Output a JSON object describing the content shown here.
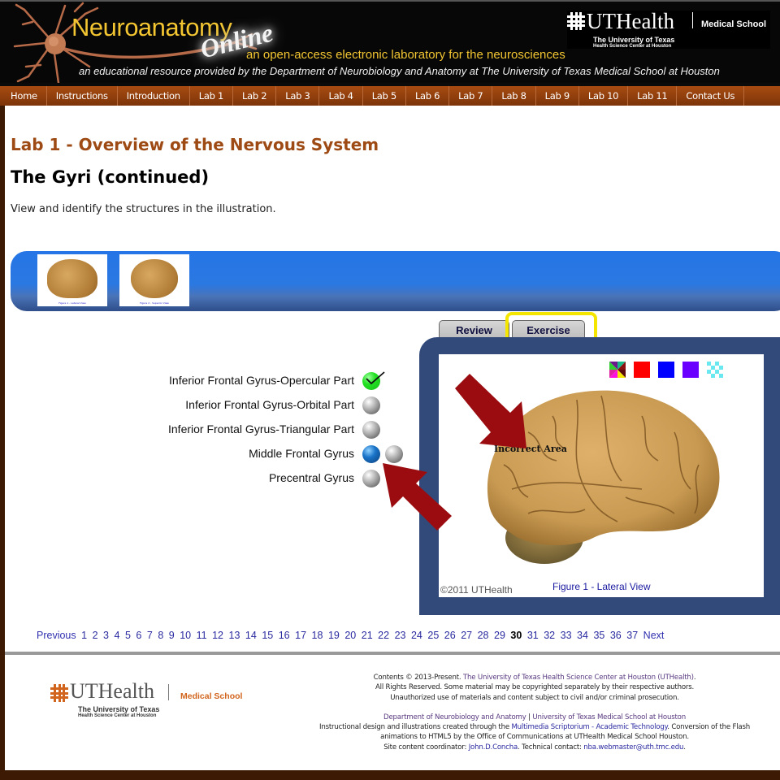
{
  "header": {
    "site_title": "Neuroanatomy",
    "site_title_accent": "Online",
    "tagline": "an open-access electronic laboratory for the neurosciences",
    "subtitle": "an educational resource provided by the Department of Neurobiology and Anatomy at The University of Texas Medical School at Houston",
    "logo": {
      "name": "UTHealth",
      "school": "Medical School",
      "university": "The University of Texas",
      "center": "Health Science Center at Houston"
    }
  },
  "nav": {
    "items": [
      {
        "label": "Home"
      },
      {
        "label": "Instructions"
      },
      {
        "label": "Introduction"
      },
      {
        "label": "Lab 1"
      },
      {
        "label": "Lab 2"
      },
      {
        "label": "Lab 3"
      },
      {
        "label": "Lab 4"
      },
      {
        "label": "Lab 5"
      },
      {
        "label": "Lab 6"
      },
      {
        "label": "Lab 7"
      },
      {
        "label": "Lab 8"
      },
      {
        "label": "Lab 9"
      },
      {
        "label": "Lab 10"
      },
      {
        "label": "Lab 11"
      },
      {
        "label": "Contact Us"
      }
    ]
  },
  "main": {
    "lab_title": "Lab 1 - Overview of the Nervous System",
    "page_title": "The Gyri (continued)",
    "instructions": "View and identify the structures in the illustration.",
    "thumbnails": [
      {
        "caption": "Figure 1 - Lateral View"
      },
      {
        "caption": "Figure 2 - Superior View"
      }
    ],
    "questions": [
      {
        "label": "Inferior Frontal Gyrus-Opercular Part",
        "state": "correct"
      },
      {
        "label": "Inferior Frontal Gyrus-Orbital Part",
        "state": "unanswered"
      },
      {
        "label": "Inferior Frontal Gyrus-Triangular Part",
        "state": "unanswered"
      },
      {
        "label": "Middle Frontal Gyrus",
        "state": "selected"
      },
      {
        "label": "Precentral Gyrus",
        "state": "unanswered"
      }
    ],
    "tabs": [
      {
        "label": "Review",
        "active": false
      },
      {
        "label": "Exercise",
        "active": true
      }
    ],
    "figure": {
      "feedback_label": "Incorrect Area",
      "copyright": "©2011 UTHealth",
      "caption": "Figure 1 - Lateral View",
      "color_swatches": [
        {
          "name": "multicolor",
          "color": "multi"
        },
        {
          "name": "red",
          "color": "#ff0000"
        },
        {
          "name": "blue",
          "color": "#0000ff"
        },
        {
          "name": "violet",
          "color": "#6a00ff"
        },
        {
          "name": "cyan-checker",
          "color": "#7ff0f0"
        }
      ]
    }
  },
  "pagination": {
    "previous": "Previous",
    "next": "Next",
    "pages": [
      "1",
      "2",
      "3",
      "4",
      "5",
      "6",
      "7",
      "8",
      "9",
      "10",
      "11",
      "12",
      "13",
      "14",
      "15",
      "16",
      "17",
      "18",
      "19",
      "20",
      "21",
      "22",
      "23",
      "24",
      "25",
      "26",
      "27",
      "28",
      "29",
      "30",
      "31",
      "32",
      "33",
      "34",
      "35",
      "36",
      "37"
    ],
    "current": "30"
  },
  "footer": {
    "contents_prefix": "Contents © 2013-Present.",
    "institution_link": "The University of Texas Health Science Center at Houston (UTHealth)",
    "rights": "All Rights Reserved. Some material may be copyrighted separately by their respective authors.",
    "unauthorized": "Unauthorized use of materials and content subject to civil and/or criminal prosecution.",
    "dept_link": "Department of Neurobiology and Anatomy",
    "separator": "|",
    "school_link": "University of Texas Medical School at Houston",
    "design_prefix": "Instructional design and illustrations created through the",
    "scriptorium_link": "Multimedia Scriptorium - Academic Technology",
    "design_suffix": ". Conversion of the Flash animations to HTML5 by the Office of Communications at UTHealth Medical School Houston.",
    "coordinator_prefix": "Site content coordinator:",
    "coordinator_link": "John.D.Concha",
    "technical_prefix": ". Technical contact:",
    "technical_link": "nba.webmaster@uth.tmc.edu",
    "end": "."
  },
  "colors": {
    "nav_bg": "#8f3f0d",
    "lab_title": "#9e4a14",
    "panel": "#324a7a",
    "thumb_bar": "#2575e6",
    "highlight": "#f5e600",
    "arrow": "#9a0c10"
  }
}
